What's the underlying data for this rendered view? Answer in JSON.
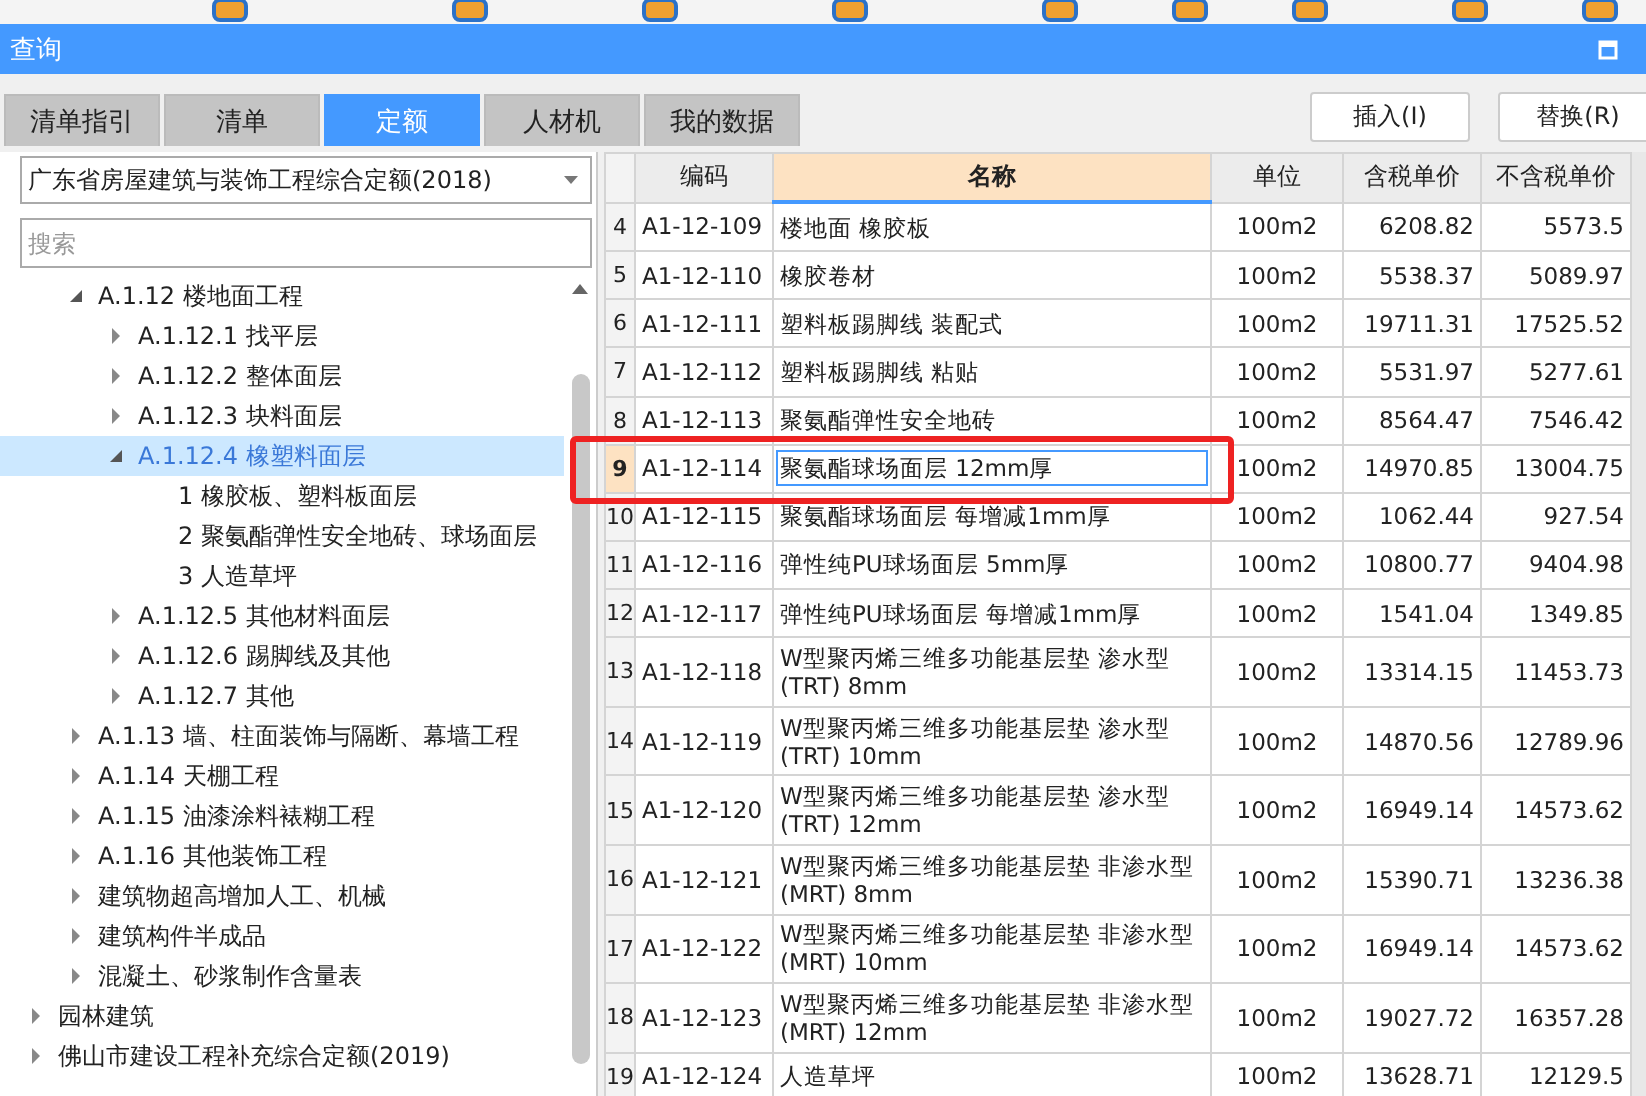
{
  "window": {
    "title": "查询"
  },
  "tabs": [
    {
      "label": "清单指引",
      "selected": false
    },
    {
      "label": "清单",
      "selected": false
    },
    {
      "label": "定额",
      "selected": true
    },
    {
      "label": "人材机",
      "selected": false
    },
    {
      "label": "我的数据",
      "selected": false
    }
  ],
  "actions": [
    "插入(I)",
    "替换(R)"
  ],
  "library_select": {
    "value": "广东省房屋建筑与装饰工程综合定额(2018)"
  },
  "search": {
    "placeholder": "搜索"
  },
  "tree": {
    "nested_items": [
      {
        "label": "A.1.12 楼地面工程",
        "expanded": true,
        "selected": false,
        "children": [
          {
            "label": "A.1.12.1 找平层",
            "expanded": false,
            "selected": false
          },
          {
            "label": "A.1.12.2 整体面层",
            "expanded": false,
            "selected": false
          },
          {
            "label": "A.1.12.3 块料面层",
            "expanded": false,
            "selected": false
          },
          {
            "label": "A.1.12.4 橡塑料面层",
            "expanded": true,
            "selected": true,
            "children": [
              {
                "label": "1 橡胶板、塑料板面层",
                "selected": false
              },
              {
                "label": "2 聚氨酯弹性安全地砖、球场面层",
                "selected": false
              },
              {
                "label": "3 人造草坪",
                "selected": false
              }
            ]
          },
          {
            "label": "A.1.12.5 其他材料面层",
            "expanded": false,
            "selected": false
          },
          {
            "label": "A.1.12.6 踢脚线及其他",
            "expanded": false,
            "selected": false
          },
          {
            "label": "A.1.12.7 其他",
            "expanded": false,
            "selected": false
          }
        ]
      },
      {
        "label": "A.1.13 墙、柱面装饰与隔断、幕墙工程",
        "expanded": false,
        "selected": false
      },
      {
        "label": "A.1.14 天棚工程",
        "expanded": false,
        "selected": false
      },
      {
        "label": "A.1.15 油漆涂料裱糊工程",
        "expanded": false,
        "selected": false
      },
      {
        "label": "A.1.16 其他装饰工程",
        "expanded": false,
        "selected": false
      },
      {
        "label": "建筑物超高增加人工、机械",
        "expanded": false,
        "selected": false
      },
      {
        "label": "建筑构件半成品",
        "expanded": false,
        "selected": false
      },
      {
        "label": "混凝土、砂浆制作含量表",
        "expanded": false,
        "selected": false
      }
    ],
    "top_level_items": [
      {
        "label": "园林建筑",
        "expanded": false,
        "selected": false
      },
      {
        "label": "佛山市建设工程补充综合定额(2019)",
        "expanded": false,
        "selected": false
      }
    ]
  },
  "table": {
    "columns": [
      "编码",
      "名称",
      "单位",
      "含税单价",
      "不含税单价"
    ],
    "rows": [
      {
        "no": "4",
        "code": "A1-12-109",
        "name": "楼地面 橡胶板",
        "unit": "100m2",
        "price_tax": "6208.82",
        "price_notax": "5573.5",
        "selected": false,
        "circled": false
      },
      {
        "no": "5",
        "code": "A1-12-110",
        "name": "橡胶卷材",
        "unit": "100m2",
        "price_tax": "5538.37",
        "price_notax": "5089.97",
        "selected": false,
        "circled": false
      },
      {
        "no": "6",
        "code": "A1-12-111",
        "name": "塑料板踢脚线 装配式",
        "unit": "100m2",
        "price_tax": "19711.31",
        "price_notax": "17525.52",
        "selected": false,
        "circled": false
      },
      {
        "no": "7",
        "code": "A1-12-112",
        "name": "塑料板踢脚线 粘贴",
        "unit": "100m2",
        "price_tax": "5531.97",
        "price_notax": "5277.61",
        "selected": false,
        "circled": false
      },
      {
        "no": "8",
        "code": "A1-12-113",
        "name": "聚氨酯弹性安全地砖",
        "unit": "100m2",
        "price_tax": "8564.47",
        "price_notax": "7546.42",
        "selected": false,
        "circled": false
      },
      {
        "no": "9",
        "code": "A1-12-114",
        "name": "聚氨酯球场面层 12mm厚",
        "unit": "100m2",
        "price_tax": "14970.85",
        "price_notax": "13004.75",
        "selected": true,
        "circled": true
      },
      {
        "no": "10",
        "code": "A1-12-115",
        "name": "聚氨酯球场面层 每增减1mm厚",
        "unit": "100m2",
        "price_tax": "1062.44",
        "price_notax": "927.54",
        "selected": false,
        "circled": false
      },
      {
        "no": "11",
        "code": "A1-12-116",
        "name": "弹性纯PU球场面层 5mm厚",
        "unit": "100m2",
        "price_tax": "10800.77",
        "price_notax": "9404.98",
        "selected": false,
        "circled": false
      },
      {
        "no": "12",
        "code": "A1-12-117",
        "name": "弹性纯PU球场面层 每增减1mm厚",
        "unit": "100m2",
        "price_tax": "1541.04",
        "price_notax": "1349.85",
        "selected": false,
        "circled": false
      },
      {
        "no": "13",
        "code": "A1-12-118",
        "name": "W型聚丙烯三维多功能基层垫 渗水型 (TRT) 8mm",
        "unit": "100m2",
        "price_tax": "13314.15",
        "price_notax": "11453.73",
        "selected": false,
        "circled": false
      },
      {
        "no": "14",
        "code": "A1-12-119",
        "name": "W型聚丙烯三维多功能基层垫 渗水型 (TRT) 10mm",
        "unit": "100m2",
        "price_tax": "14870.56",
        "price_notax": "12789.96",
        "selected": false,
        "circled": false
      },
      {
        "no": "15",
        "code": "A1-12-120",
        "name": "W型聚丙烯三维多功能基层垫 渗水型 (TRT) 12mm",
        "unit": "100m2",
        "price_tax": "16949.14",
        "price_notax": "14573.62",
        "selected": false,
        "circled": false
      },
      {
        "no": "16",
        "code": "A1-12-121",
        "name": "W型聚丙烯三维多功能基层垫 非渗水型 (MRT) 8mm",
        "unit": "100m2",
        "price_tax": "15390.71",
        "price_notax": "13236.38",
        "selected": false,
        "circled": false
      },
      {
        "no": "17",
        "code": "A1-12-122",
        "name": "W型聚丙烯三维多功能基层垫 非渗水型 (MRT) 10mm",
        "unit": "100m2",
        "price_tax": "16949.14",
        "price_notax": "14573.62",
        "selected": false,
        "circled": false
      },
      {
        "no": "18",
        "code": "A1-12-123",
        "name": "W型聚丙烯三维多功能基层垫 非渗水型 (MRT) 12mm",
        "unit": "100m2",
        "price_tax": "19027.72",
        "price_notax": "16357.28",
        "selected": false,
        "circled": false
      },
      {
        "no": "19",
        "code": "A1-12-124",
        "name": "人造草坪",
        "unit": "100m2",
        "price_tax": "13628.71",
        "price_notax": "12129.5",
        "selected": false,
        "circled": false
      }
    ]
  }
}
